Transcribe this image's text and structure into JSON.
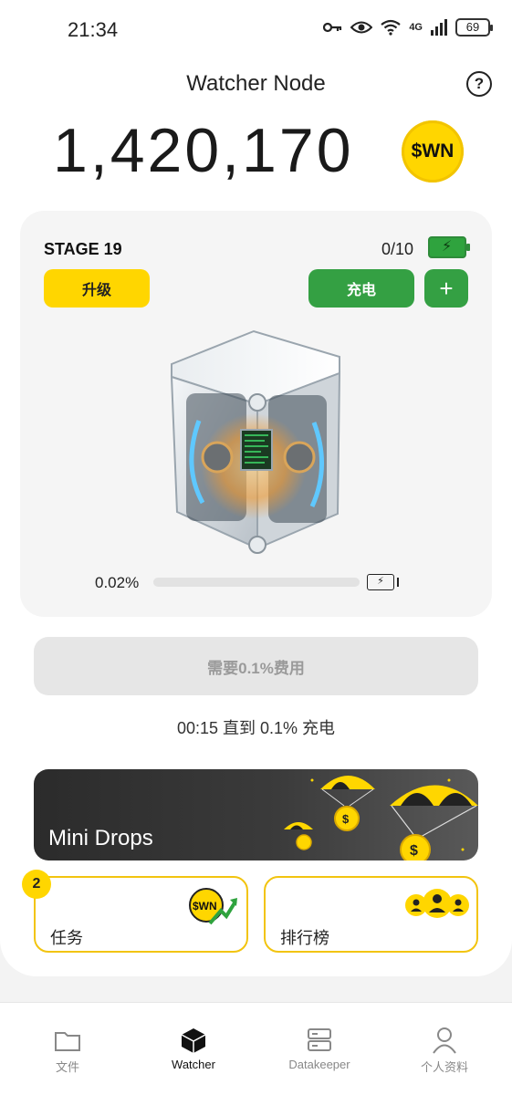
{
  "status_bar": {
    "time": "21:34",
    "network": "4G",
    "battery": "69",
    "icons": [
      "key-icon",
      "eye-icon",
      "wifi-icon",
      "signal-icon",
      "battery-icon"
    ]
  },
  "header": {
    "title": "Watcher Node",
    "help_label": "?"
  },
  "balance": {
    "amount": "1,420,170",
    "coin_label": "$WN"
  },
  "node": {
    "stage": "STAGE 19",
    "charge_count": "0/10",
    "upgrade_label": "升级",
    "charge_label": "充电",
    "add_label": "+",
    "progress_text": "0.02%",
    "progress_fraction": 0.0002
  },
  "fee_button": {
    "label": "需要0.1%费用"
  },
  "countdown": "00:15 直到 0.1% 充电",
  "mini_drops": {
    "title": "Mini Drops"
  },
  "tiles": {
    "tasks": {
      "label": "任务",
      "badge": "2",
      "coin_label": "$WN"
    },
    "leaderboard": {
      "label": "排行榜"
    }
  },
  "nav": {
    "items": [
      {
        "label": "文件",
        "icon": "folder-icon",
        "active": false
      },
      {
        "label": "Watcher",
        "icon": "cube-icon",
        "active": true
      },
      {
        "label": "Datakeeper",
        "icon": "server-icon",
        "active": false
      },
      {
        "label": "个人资料",
        "icon": "person-icon",
        "active": false
      }
    ]
  },
  "colors": {
    "accent_yellow": "#FFD600",
    "accent_green": "#34a043",
    "disabled_bg": "#e6e6e6",
    "dark_banner": "#2b2b2b"
  }
}
